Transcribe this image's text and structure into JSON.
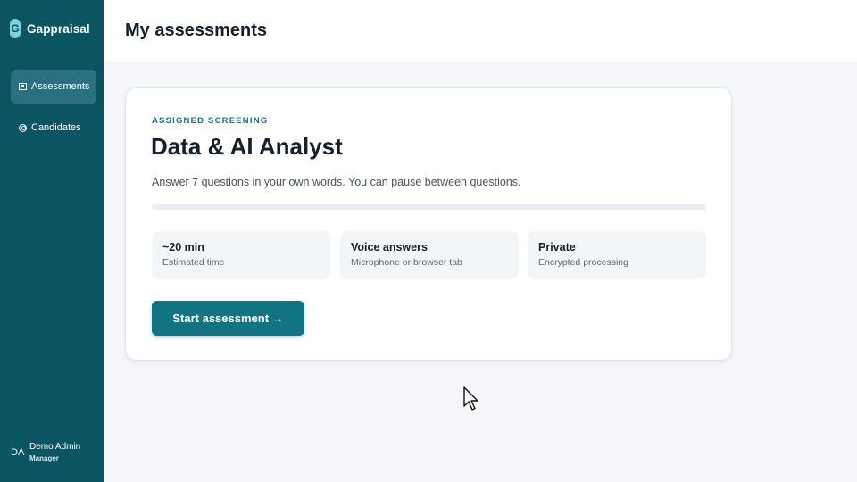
{
  "brand": {
    "mark": "G",
    "name": "Gappraisal"
  },
  "sidebar": {
    "items": [
      {
        "label": "Assessments",
        "icon": "assessments-icon",
        "active": true
      },
      {
        "label": "Candidates",
        "icon": "candidates-icon",
        "active": false
      }
    ],
    "user": {
      "initials": "DA",
      "name": "Demo Admin",
      "role": "Manager"
    }
  },
  "header": {
    "title": "My assessments"
  },
  "card": {
    "eyebrow": "ASSIGNED SCREENING",
    "title": "Data & AI Analyst",
    "description": "Answer 7 questions in your own words. You can pause between questions.",
    "progress_percent": 0,
    "info": [
      {
        "title": "~20 min",
        "subtitle": "Estimated time"
      },
      {
        "title": "Voice answers",
        "subtitle": "Microphone or browser tab"
      },
      {
        "title": "Private",
        "subtitle": "Encrypted processing"
      }
    ],
    "start_label": "Start assessment →"
  },
  "colors": {
    "sidebar": "#0b5563",
    "accent": "#127383",
    "active_nav": "#2b7080",
    "background": "#f5f7fa"
  }
}
